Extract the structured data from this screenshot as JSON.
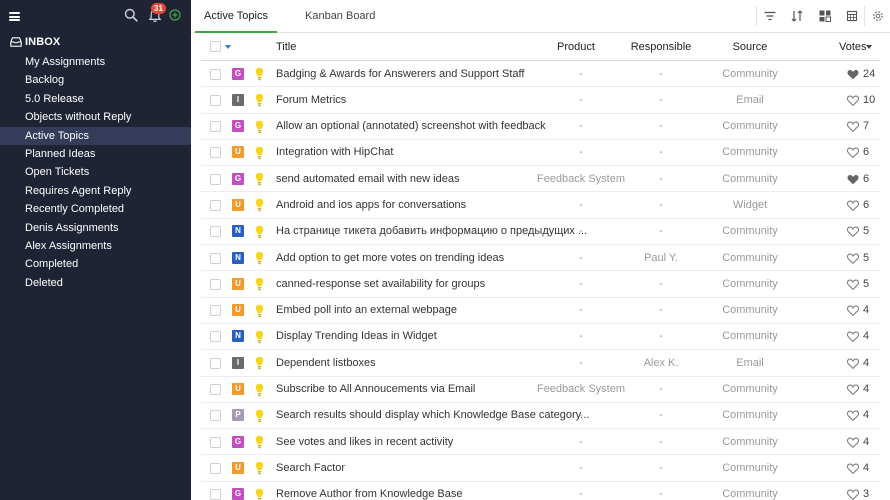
{
  "sidebar": {
    "notification_count": "31",
    "inbox_label": "INBOX",
    "items": [
      {
        "label": "My Assignments"
      },
      {
        "label": "Backlog"
      },
      {
        "label": "5.0 Release"
      },
      {
        "label": "Objects without Reply"
      },
      {
        "label": "Active Topics",
        "active": true
      },
      {
        "label": "Planned Ideas"
      },
      {
        "label": "Open Tickets"
      },
      {
        "label": "Requires Agent Reply"
      },
      {
        "label": "Recently Completed"
      },
      {
        "label": "Denis Assignments"
      },
      {
        "label": "Alex Assignments"
      },
      {
        "label": "Completed"
      },
      {
        "label": "Deleted"
      }
    ]
  },
  "topbar": {
    "tabs": [
      {
        "label": "Active Topics",
        "active": true
      },
      {
        "label": "Kanban Board"
      }
    ],
    "icons": [
      "filter-icon",
      "sort-icon",
      "layout-grid-icon",
      "calendar-icon",
      "settings-icon"
    ]
  },
  "table": {
    "headers": {
      "title": "Title",
      "product": "Product",
      "responsible": "Responsible",
      "source": "Source",
      "votes": "Votes"
    },
    "type_colors": {
      "G": "#c04fc0",
      "I": "#6a6a6a",
      "U": "#f29a2e",
      "N": "#2a5fbf",
      "P": "#a79bb3"
    },
    "rows": [
      {
        "type": "G",
        "title": "Badging & Awards for Answerers and Support Staff",
        "product": "-",
        "responsible": "-",
        "source": "Community",
        "votes": "24",
        "voted": true
      },
      {
        "type": "I",
        "title": "Forum Metrics",
        "product": "-",
        "responsible": "-",
        "source": "Email",
        "votes": "10",
        "voted": false
      },
      {
        "type": "G",
        "title": "Allow an optional (annotated) screenshot with feedback",
        "product": "-",
        "responsible": "-",
        "source": "Community",
        "votes": "7",
        "voted": false
      },
      {
        "type": "U",
        "title": "Integration with HipChat",
        "product": "-",
        "responsible": "-",
        "source": "Community",
        "votes": "6",
        "voted": false
      },
      {
        "type": "G",
        "title": "send automated email with new ideas",
        "product": "Feedback System",
        "responsible": "-",
        "source": "Community",
        "votes": "6",
        "voted": true
      },
      {
        "type": "U",
        "title": "Android and ios apps for conversations",
        "product": "-",
        "responsible": "-",
        "source": "Widget",
        "votes": "6",
        "voted": false
      },
      {
        "type": "N",
        "title": "На странице тикета добавить информацию о предыдущих ...",
        "product": "-",
        "responsible": "-",
        "source": "Community",
        "votes": "5",
        "voted": false
      },
      {
        "type": "N",
        "title": "Add option to get more votes on trending ideas",
        "product": "-",
        "responsible": "Paul Y.",
        "source": "Community",
        "votes": "5",
        "voted": false
      },
      {
        "type": "U",
        "title": "canned-response set availability for groups",
        "product": "-",
        "responsible": "-",
        "source": "Community",
        "votes": "5",
        "voted": false
      },
      {
        "type": "U",
        "title": "Embed poll into an external webpage",
        "product": "-",
        "responsible": "-",
        "source": "Community",
        "votes": "4",
        "voted": false
      },
      {
        "type": "N",
        "title": "Display Trending Ideas in Widget",
        "product": "-",
        "responsible": "-",
        "source": "Community",
        "votes": "4",
        "voted": false
      },
      {
        "type": "I",
        "title": "Dependent listboxes",
        "product": "-",
        "responsible": "Alex K.",
        "source": "Email",
        "votes": "4",
        "voted": false
      },
      {
        "type": "U",
        "title": "Subscribe to All Annoucements via Email",
        "product": "Feedback System",
        "responsible": "-",
        "source": "Community",
        "votes": "4",
        "voted": false
      },
      {
        "type": "P",
        "title": "Search results should display which Knowledge Base category...",
        "product": "-",
        "responsible": "-",
        "source": "Community",
        "votes": "4",
        "voted": false
      },
      {
        "type": "G",
        "title": "See votes and likes in recent activity",
        "product": "-",
        "responsible": "-",
        "source": "Community",
        "votes": "4",
        "voted": false
      },
      {
        "type": "U",
        "title": "Search Factor",
        "product": "-",
        "responsible": "-",
        "source": "Community",
        "votes": "4",
        "voted": false
      },
      {
        "type": "G",
        "title": "Remove Author from Knowledge Base",
        "product": "-",
        "responsible": "-",
        "source": "Community",
        "votes": "3",
        "voted": false
      }
    ]
  }
}
